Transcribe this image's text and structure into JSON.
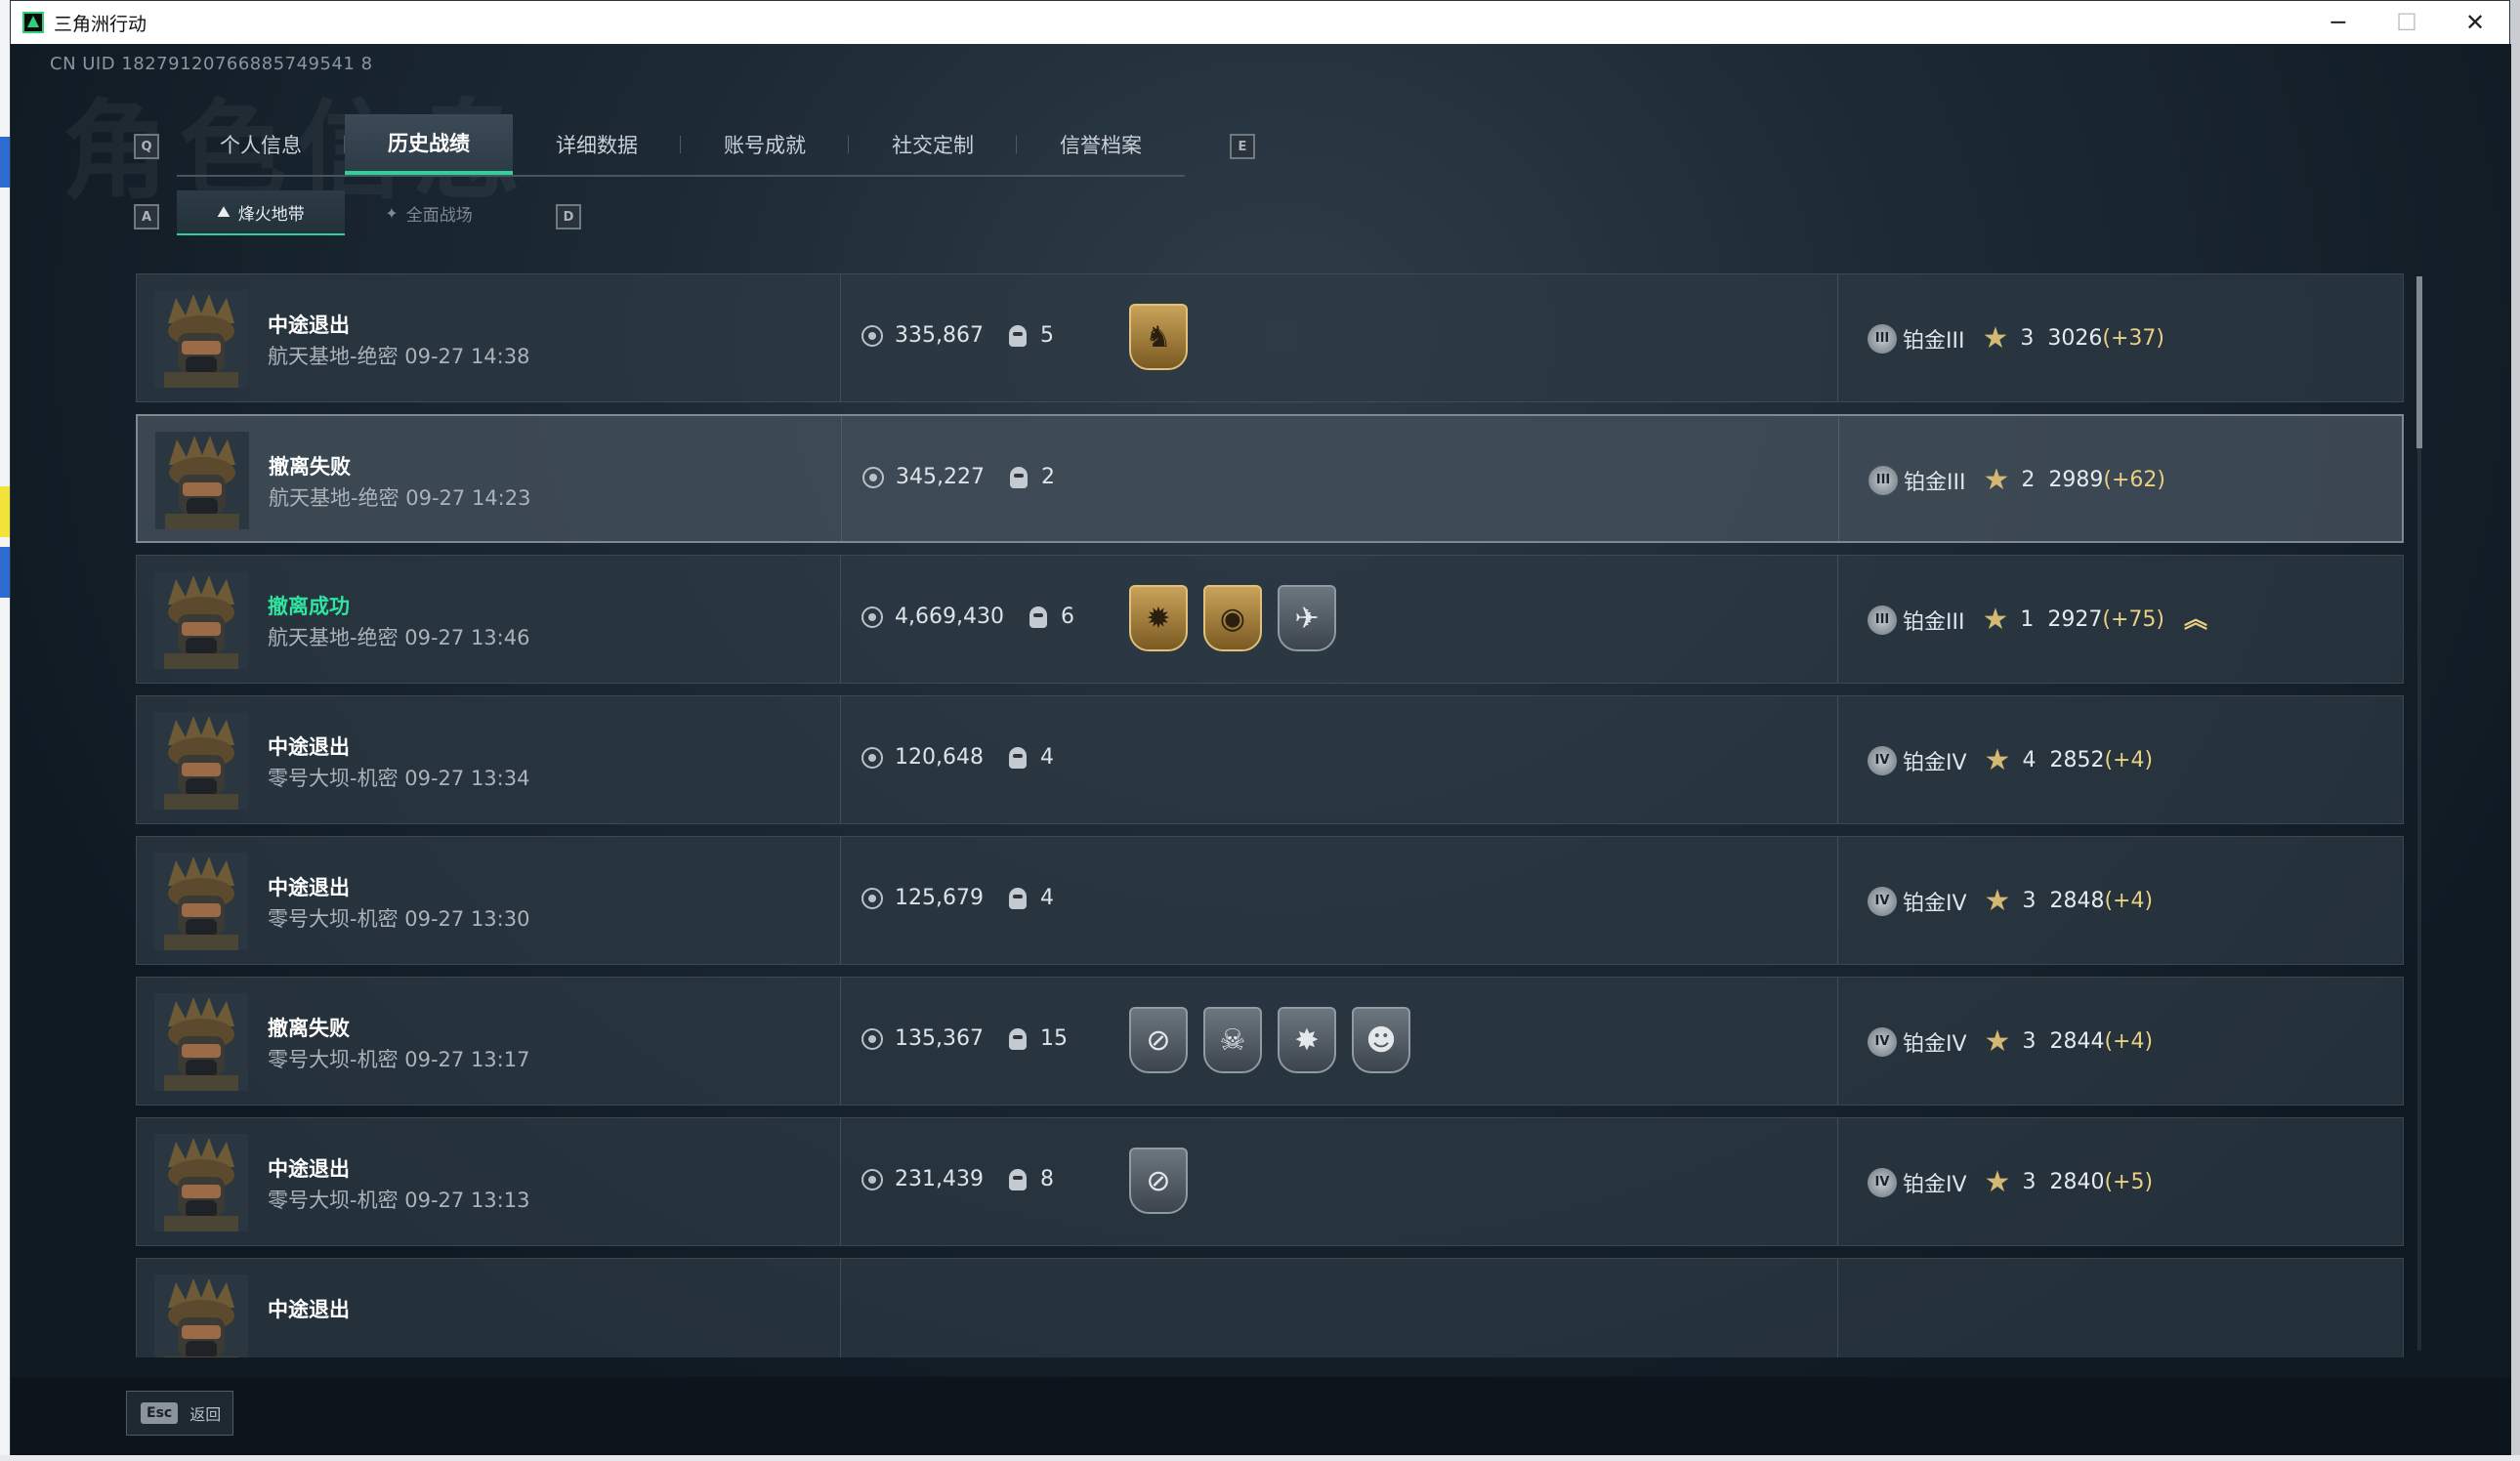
{
  "window": {
    "title": "三角洲行动",
    "min": "─",
    "max": "☐",
    "close": "✕"
  },
  "uid": "CN UID 18279120766885749541 8",
  "watermark": "角色信息",
  "keys": {
    "prev_tab": "Q",
    "next_tab": "E",
    "prev_sub": "A",
    "next_sub": "D"
  },
  "tabs": [
    "个人信息",
    "历史战绩",
    "详细数据",
    "账号成就",
    "社交定制",
    "信誉档案"
  ],
  "subtabs": [
    {
      "label": "烽火地带",
      "icon": "⛰"
    },
    {
      "label": "全面战场",
      "icon": "✦"
    }
  ],
  "rows": [
    {
      "result": "中途退出",
      "map": "航天基地-绝密 09-27 14:38",
      "coins": "335,867",
      "kills": "5",
      "badges": [
        {
          "tone": "gold",
          "icon": "♞"
        }
      ],
      "rank_icon": "III",
      "rank": "铂金III",
      "stars": "3",
      "score": "3026",
      "delta": "(+37)"
    },
    {
      "result": "撤离失败",
      "map": "航天基地-绝密 09-27 14:23",
      "coins": "345,227",
      "kills": "2",
      "badges": [],
      "rank_icon": "III",
      "rank": "铂金III",
      "stars": "2",
      "score": "2989",
      "delta": "(+62)"
    },
    {
      "result": "撤离成功",
      "map": "航天基地-绝密 09-27 13:46",
      "coins": "4,669,430",
      "kills": "6",
      "badges": [
        {
          "tone": "gold",
          "icon": "✹"
        },
        {
          "tone": "gold",
          "icon": "◉"
        },
        {
          "tone": "grey",
          "icon": "✈"
        }
      ],
      "rank_icon": "III",
      "rank": "铂金III",
      "stars": "1",
      "score": "2927",
      "delta": "(+75)",
      "chevron": "︽"
    },
    {
      "result": "中途退出",
      "map": "零号大坝-机密 09-27 13:34",
      "coins": "120,648",
      "kills": "4",
      "badges": [],
      "rank_icon": "IV",
      "rank": "铂金IV",
      "stars": "4",
      "score": "2852",
      "delta": "(+4)"
    },
    {
      "result": "中途退出",
      "map": "零号大坝-机密 09-27 13:30",
      "coins": "125,679",
      "kills": "4",
      "badges": [],
      "rank_icon": "IV",
      "rank": "铂金IV",
      "stars": "3",
      "score": "2848",
      "delta": "(+4)"
    },
    {
      "result": "撤离失败",
      "map": "零号大坝-机密 09-27 13:17",
      "coins": "135,367",
      "kills": "15",
      "badges": [
        {
          "tone": "grey",
          "icon": "⊘"
        },
        {
          "tone": "grey",
          "icon": "☠"
        },
        {
          "tone": "grey",
          "icon": "✸"
        },
        {
          "tone": "grey",
          "icon": "☻"
        }
      ],
      "rank_icon": "IV",
      "rank": "铂金IV",
      "stars": "3",
      "score": "2844",
      "delta": "(+4)"
    },
    {
      "result": "中途退出",
      "map": "零号大坝-机密 09-27 13:13",
      "coins": "231,439",
      "kills": "8",
      "badges": [
        {
          "tone": "grey",
          "icon": "⊘"
        }
      ],
      "rank_icon": "IV",
      "rank": "铂金IV",
      "stars": "3",
      "score": "2840",
      "delta": "(+5)"
    },
    {
      "result": "中途退出",
      "map": "",
      "coins": "",
      "kills": "",
      "badges": [],
      "rank_icon": "",
      "rank": "",
      "stars": "",
      "score": "",
      "delta": ""
    }
  ],
  "footer": {
    "esc_key": "Esc",
    "esc_label": "返回"
  }
}
